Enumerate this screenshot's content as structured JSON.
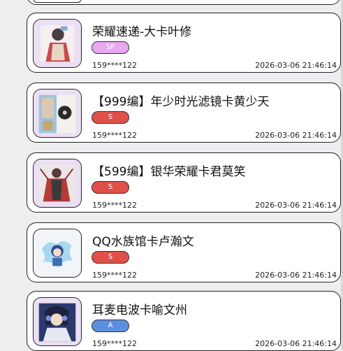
{
  "items": [
    {
      "title": "荣耀速递-大卡叶修",
      "rarity": "SP",
      "rarity_color": "#e9a8f0",
      "phone": "159****122",
      "time": "2026-03-06 21:46:14",
      "image": "card-art-ye-xiu"
    },
    {
      "title": "【999编】年少时光滤镜卡黄少天",
      "rarity": "S",
      "rarity_color": "#e0504a",
      "phone": "159****122",
      "time": "2026-03-06 21:46:14",
      "image": "card-art-huang-shaotian"
    },
    {
      "title": "【599编】银华荣耀卡君莫笑",
      "rarity": "S",
      "rarity_color": "#e0504a",
      "phone": "159****122",
      "time": "2026-03-06 21:46:14",
      "image": "card-art-jun-moxiao"
    },
    {
      "title": "QQ水族馆卡卢瀚文",
      "rarity": "S",
      "rarity_color": "#e0504a",
      "phone": "159****122",
      "time": "2026-03-06 21:46:14",
      "image": "card-art-lu-hanwen"
    },
    {
      "title": "耳麦电波卡喻文州",
      "rarity": "A",
      "rarity_color": "#5d8fe0",
      "phone": "159****122",
      "time": "2026-03-06 21:46:14",
      "image": "card-art-yu-wenzhou"
    }
  ]
}
